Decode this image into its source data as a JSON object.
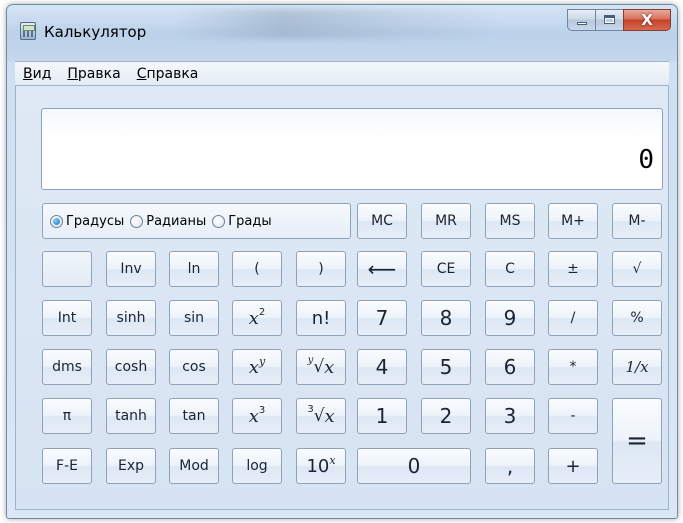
{
  "window": {
    "title": "Калькулятор",
    "close_glyph": "X"
  },
  "menu": [
    {
      "accel": "В",
      "rest": "ид"
    },
    {
      "accel": "П",
      "rest": "равка"
    },
    {
      "accel": "С",
      "rest": "правка"
    }
  ],
  "display": {
    "value": "0"
  },
  "angle_units": {
    "degrees": "Градусы",
    "radians": "Радианы",
    "grads": "Грады",
    "selected": "degrees"
  },
  "memory": {
    "mc": "MC",
    "mr": "MR",
    "ms": "MS",
    "mplus": "M+",
    "mminus": "M-"
  },
  "row2": {
    "inv": "Inv",
    "ln": "ln",
    "lparen": "(",
    "rparen": ")",
    "backspace": "⟵",
    "ce": "CE",
    "c": "C",
    "plusminus": "±",
    "sqrt": "√"
  },
  "row3": {
    "int": "Int",
    "sinh": "sinh",
    "sin": "sin",
    "x_base": "x",
    "x_sq_exp": "2",
    "factorial": "n!",
    "d7": "7",
    "d8": "8",
    "d9": "9",
    "divide": "/",
    "percent": "%"
  },
  "row4": {
    "dms": "dms",
    "cosh": "cosh",
    "cos": "cos",
    "xy_base": "x",
    "xy_exp": "y",
    "yroot_pre": "y",
    "yroot_sym": "√",
    "yroot_base": "x",
    "d4": "4",
    "d5": "5",
    "d6": "6",
    "multiply": "*",
    "recip": "1/x"
  },
  "row5": {
    "pi": "π",
    "tanh": "tanh",
    "tan": "tan",
    "x3_base": "x",
    "x3_exp": "3",
    "cbrt_pre": "3",
    "cbrt_sym": "√",
    "cbrt_base": "x",
    "d1": "1",
    "d2": "2",
    "d3": "3",
    "minus": "-",
    "equals": "="
  },
  "row6": {
    "fe": "F-E",
    "exp": "Exp",
    "mod": "Mod",
    "log": "log",
    "ten_base": "10",
    "ten_exp": "x",
    "d0": "0",
    "decimal": ",",
    "plus": "+"
  }
}
